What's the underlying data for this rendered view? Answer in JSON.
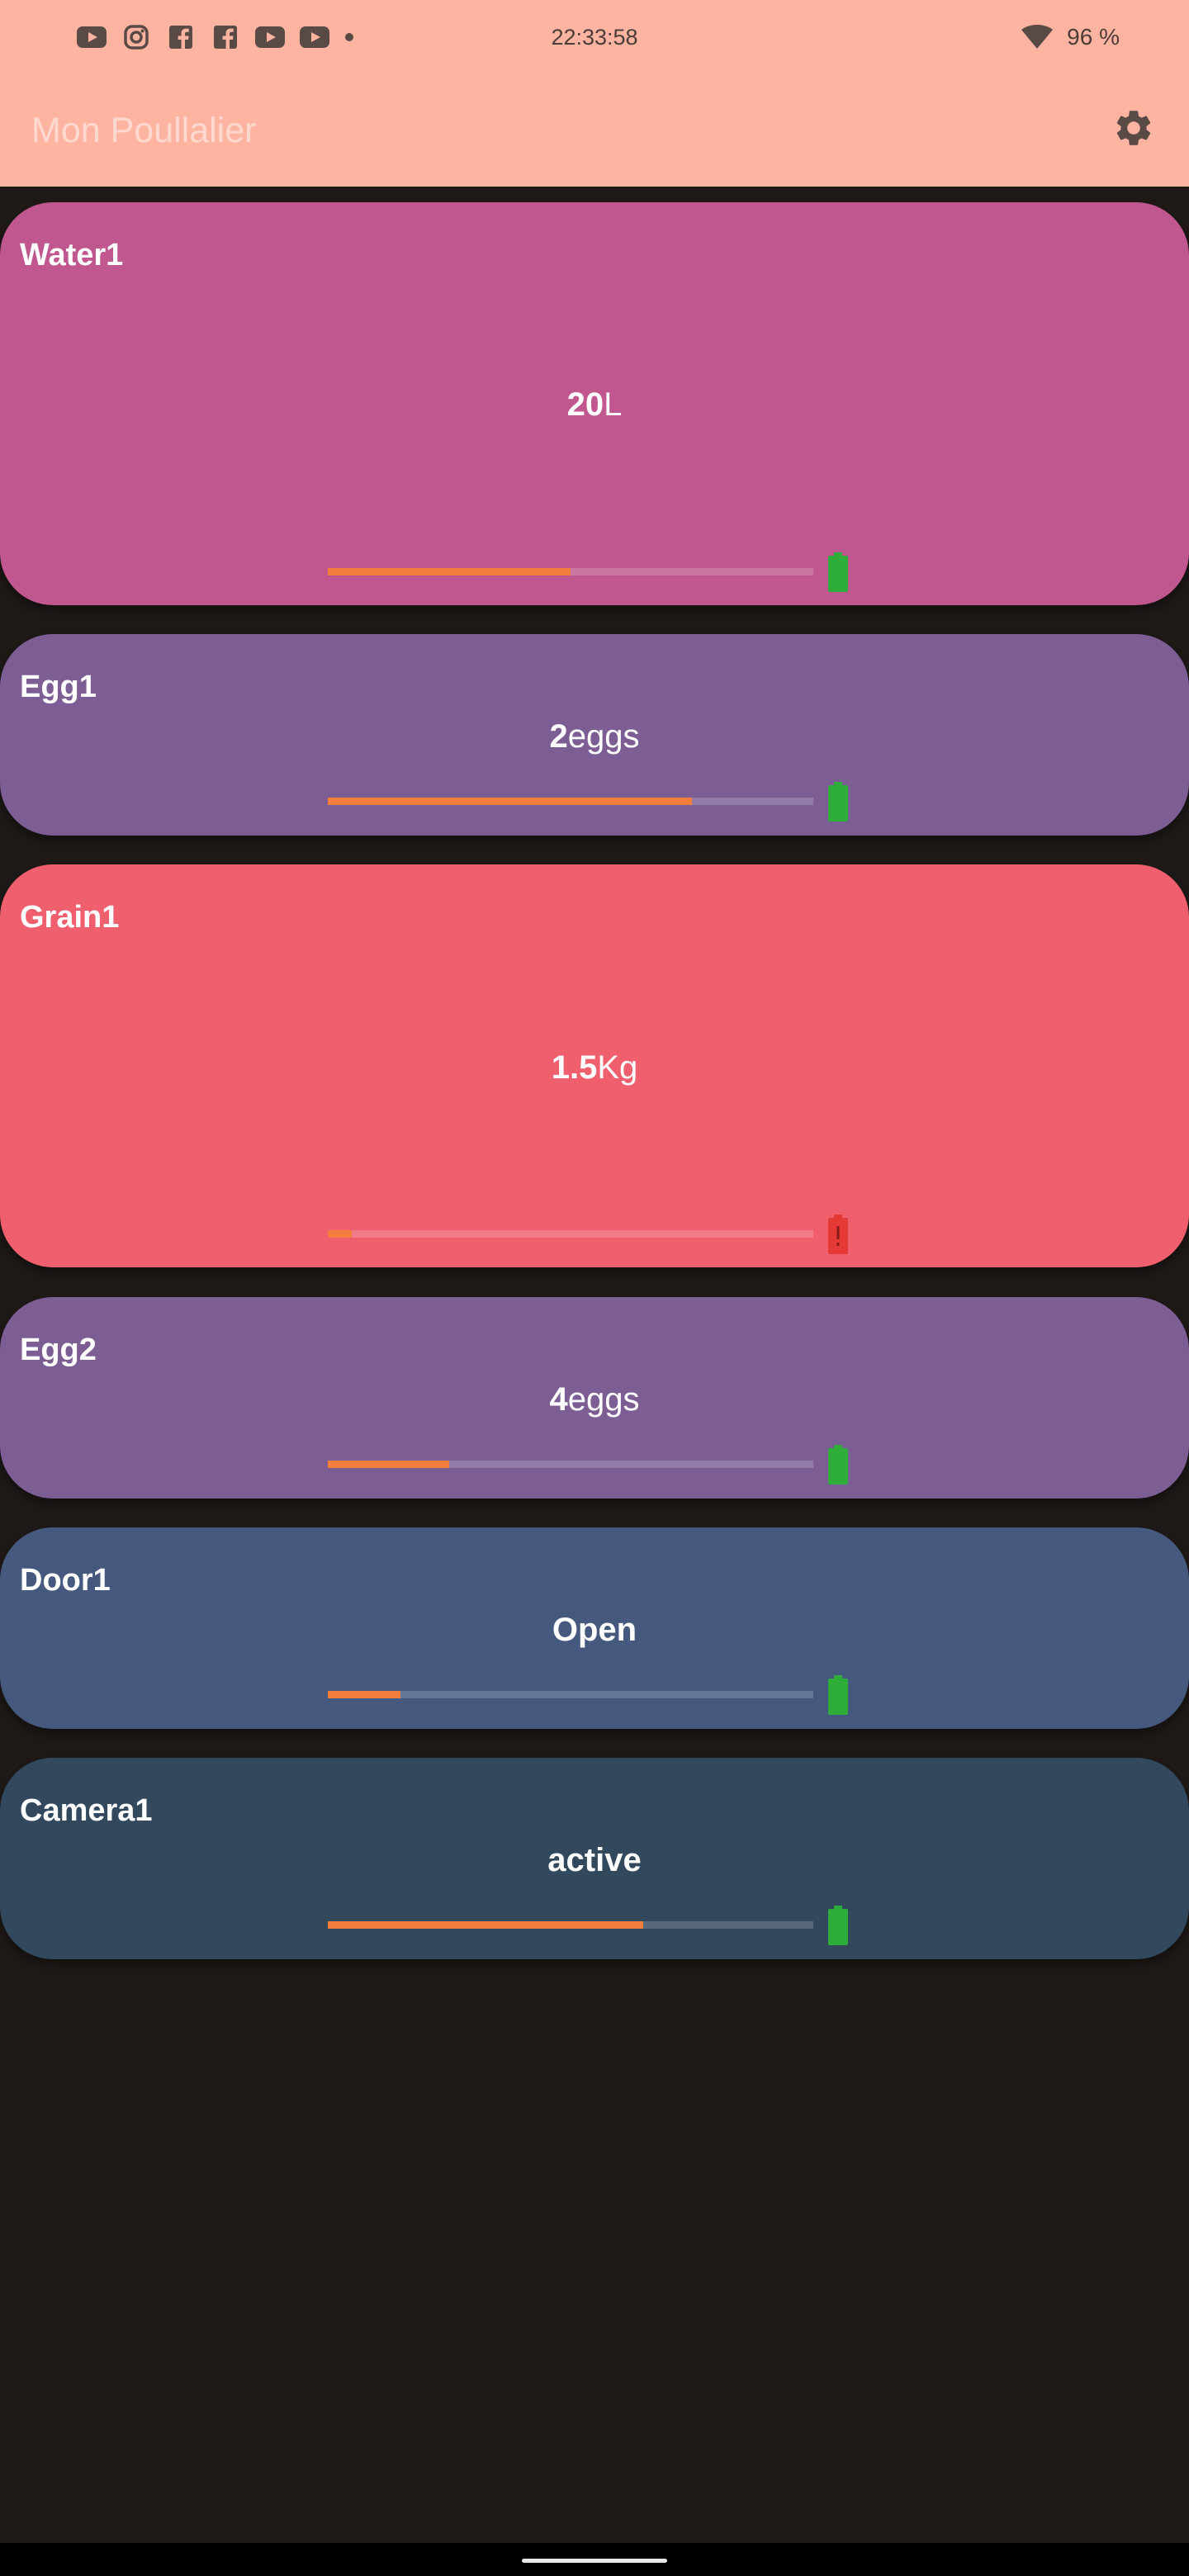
{
  "status_bar": {
    "time": "22:33:58",
    "battery": "96 %",
    "notification_icons": [
      "youtube-icon",
      "instagram-icon",
      "facebook-icon",
      "facebook-icon",
      "youtube-icon",
      "youtube-icon"
    ]
  },
  "app_bar": {
    "title": "Mon Poullalier",
    "settings_icon": "gear-icon"
  },
  "colors": {
    "header": "#ffb4a1",
    "background": "#1f1a18",
    "progress": "#f37e3b",
    "battery_ok": "#2fad3a",
    "battery_low": "#e53935"
  },
  "cards": [
    {
      "title": "Water1",
      "value": "20",
      "unit": "L",
      "level": 0.5,
      "battery": "ok",
      "color": "#c0578e"
    },
    {
      "title": "Egg1",
      "value": "2",
      "unit": "eggs",
      "level": 0.75,
      "battery": "ok",
      "color": "#7c5e95"
    },
    {
      "title": "Grain1",
      "value": "1.5",
      "unit": "Kg",
      "level": 0.05,
      "battery": "low",
      "color": "#ef5f6e"
    },
    {
      "title": "Egg2",
      "value": "4",
      "unit": "eggs",
      "level": 0.25,
      "battery": "ok",
      "color": "#7c5e95"
    },
    {
      "title": "Door1",
      "value": "Open",
      "unit": "",
      "level": 0.15,
      "battery": "ok",
      "color": "#45597e"
    },
    {
      "title": "Camera1",
      "value": "active",
      "unit": "",
      "level": 0.65,
      "battery": "ok",
      "color": "#32495d"
    }
  ]
}
